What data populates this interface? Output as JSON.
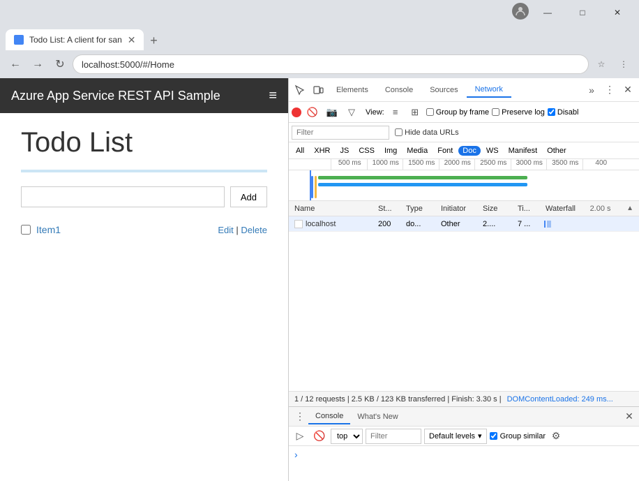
{
  "window": {
    "title_bar": {
      "profile_icon": "person"
    }
  },
  "browser": {
    "tab": {
      "title": "Todo List: A client for san",
      "favicon": "doc"
    },
    "address": "localhost:5000/#/Home",
    "nav": {
      "back": "←",
      "forward": "→",
      "reload": "↻"
    }
  },
  "webpage": {
    "navbar": {
      "brand": "Azure App Service REST API Sample",
      "hamburger": "≡"
    },
    "title": "Todo List",
    "add_button": "Add",
    "add_placeholder": "",
    "todo_items": [
      {
        "id": 1,
        "text": "Item1",
        "checked": false,
        "actions": [
          "Edit",
          "Delete"
        ]
      }
    ]
  },
  "devtools": {
    "toolbar": {
      "inspect_icon": "⬚",
      "device_icon": "⬒",
      "more_icon": "⋮",
      "close_icon": "✕"
    },
    "tabs": [
      {
        "id": "elements",
        "label": "Elements",
        "active": false
      },
      {
        "id": "console",
        "label": "Console",
        "active": false
      },
      {
        "id": "sources",
        "label": "Sources",
        "active": false
      },
      {
        "id": "network",
        "label": "Network",
        "active": true
      }
    ],
    "network": {
      "record_btn": "●",
      "clear_btn": "🚫",
      "camera_btn": "📷",
      "filter_btn": "▽",
      "view_label": "View:",
      "group_by_frame_label": "Group by frame",
      "preserve_log_label": "Preserve log",
      "disable_cache_label": "Disabl",
      "filter_placeholder": "Filter",
      "hide_data_urls_label": "Hide data URLs",
      "type_filters": [
        {
          "id": "all",
          "label": "All",
          "active": false
        },
        {
          "id": "xhr",
          "label": "XHR",
          "active": false
        },
        {
          "id": "js",
          "label": "JS",
          "active": false
        },
        {
          "id": "css",
          "label": "CSS",
          "active": false
        },
        {
          "id": "img",
          "label": "Img",
          "active": false
        },
        {
          "id": "media",
          "label": "Media",
          "active": false
        },
        {
          "id": "font",
          "label": "Font",
          "active": false
        },
        {
          "id": "doc",
          "label": "Doc",
          "active": true
        },
        {
          "id": "ws",
          "label": "WS",
          "active": false
        },
        {
          "id": "manifest",
          "label": "Manifest",
          "active": false
        },
        {
          "id": "other",
          "label": "Other",
          "active": false
        }
      ],
      "timeline": {
        "marks": [
          "500 ms",
          "1000 ms",
          "1500 ms",
          "2000 ms",
          "2500 ms",
          "3000 ms",
          "3500 ms",
          "400"
        ]
      },
      "table": {
        "columns": [
          {
            "id": "name",
            "label": "Name"
          },
          {
            "id": "status",
            "label": "St..."
          },
          {
            "id": "type",
            "label": "Type"
          },
          {
            "id": "initiator",
            "label": "Initiator"
          },
          {
            "id": "size",
            "label": "Size"
          },
          {
            "id": "time",
            "label": "Ti..."
          },
          {
            "id": "waterfall",
            "label": "Waterfall",
            "extra": "2.00 s"
          }
        ],
        "rows": [
          {
            "name": "localhost",
            "status": "200",
            "type": "do...",
            "initiator": "Other",
            "size": "2....",
            "time": "7 ..."
          }
        ]
      },
      "status_bar": "1 / 12 requests  |  2.5 KB / 123 KB transferred  |  Finish: 3.30 s  |",
      "status_link": "DOMContentLoaded: 249 ms..."
    },
    "console": {
      "tabs": [
        {
          "id": "console",
          "label": "Console",
          "active": true
        },
        {
          "id": "whatsnew",
          "label": "What's New",
          "active": false
        }
      ],
      "close_icon": "✕",
      "context_select": "top",
      "filter_placeholder": "Filter",
      "levels_label": "Default levels",
      "group_similar_label": "Group similar",
      "gear_icon": "⚙",
      "prompt_arrow": "›",
      "more_btn": "⋮",
      "execute_btn": "▷",
      "clear_btn": "🚫"
    }
  }
}
